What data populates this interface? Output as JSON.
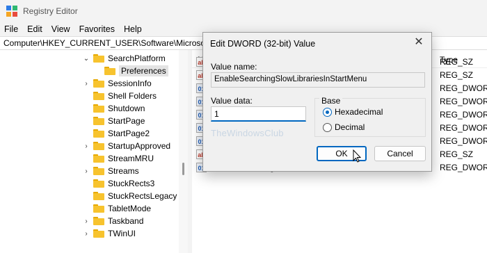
{
  "window": {
    "title": "Registry Editor",
    "brand_colors": [
      "#2c7be5",
      "#2eb872",
      "#f5a623",
      "#e84c3d"
    ]
  },
  "menu": [
    "File",
    "Edit",
    "View",
    "Favorites",
    "Help"
  ],
  "address": "Computer\\HKEY_CURRENT_USER\\Software\\Microsoft\\Windows\\CurrentVersion\\SearchSettings\\Preferences",
  "tree": [
    {
      "label": "SearchPlatform",
      "chevron": "v"
    },
    {
      "label": "Preferences",
      "chevron": ""
    },
    {
      "label": "SessionInfo",
      "chevron": ">"
    },
    {
      "label": "Shell Folders",
      "chevron": ""
    },
    {
      "label": "Shutdown",
      "chevron": ""
    },
    {
      "label": "StartPage",
      "chevron": ""
    },
    {
      "label": "StartPage2",
      "chevron": ""
    },
    {
      "label": "StartupApproved",
      "chevron": ">"
    },
    {
      "label": "StreamMRU",
      "chevron": ""
    },
    {
      "label": "Streams",
      "chevron": ">"
    },
    {
      "label": "StuckRects3",
      "chevron": ""
    },
    {
      "label": "StuckRectsLegacy",
      "chevron": ""
    },
    {
      "label": "TabletMode",
      "chevron": ""
    },
    {
      "label": "Taskband",
      "chevron": ">"
    },
    {
      "label": "TWinUI",
      "chevron": ">"
    }
  ],
  "values_pane": {
    "col_name": "N",
    "col_type": "Type",
    "rows": [
      {
        "icon": "ab",
        "name": "",
        "type": "REG_SZ"
      },
      {
        "icon": "ab",
        "name": "",
        "type": "REG_SZ"
      },
      {
        "icon": "01",
        "name": "",
        "type": "REG_DWORD"
      },
      {
        "icon": "01",
        "name": "",
        "type": "REG_DWORD"
      },
      {
        "icon": "01",
        "name": "",
        "type": "REG_DWORD"
      },
      {
        "icon": "01",
        "name": "",
        "type": "REG_DWORD"
      },
      {
        "icon": "01",
        "name": "",
        "type": "REG_DWORD"
      },
      {
        "icon": "ab",
        "name": "",
        "type": "REG_SZ"
      },
      {
        "icon": "01",
        "name": "EnableSearchingSlowLibrariesInStartMenu",
        "type": "REG_DWORD"
      }
    ]
  },
  "dialog": {
    "title": "Edit DWORD (32-bit) Value",
    "value_name_label": "Value name:",
    "value_name": "EnableSearchingSlowLibrariesInStartMenu",
    "value_data_label": "Value data:",
    "value_data": "1",
    "base_label": "Base",
    "base_options": [
      "Hexadecimal",
      "Decimal"
    ],
    "base_selected": "Hexadecimal",
    "ok": "OK",
    "cancel": "Cancel",
    "watermark": "TheWindowsClub"
  }
}
